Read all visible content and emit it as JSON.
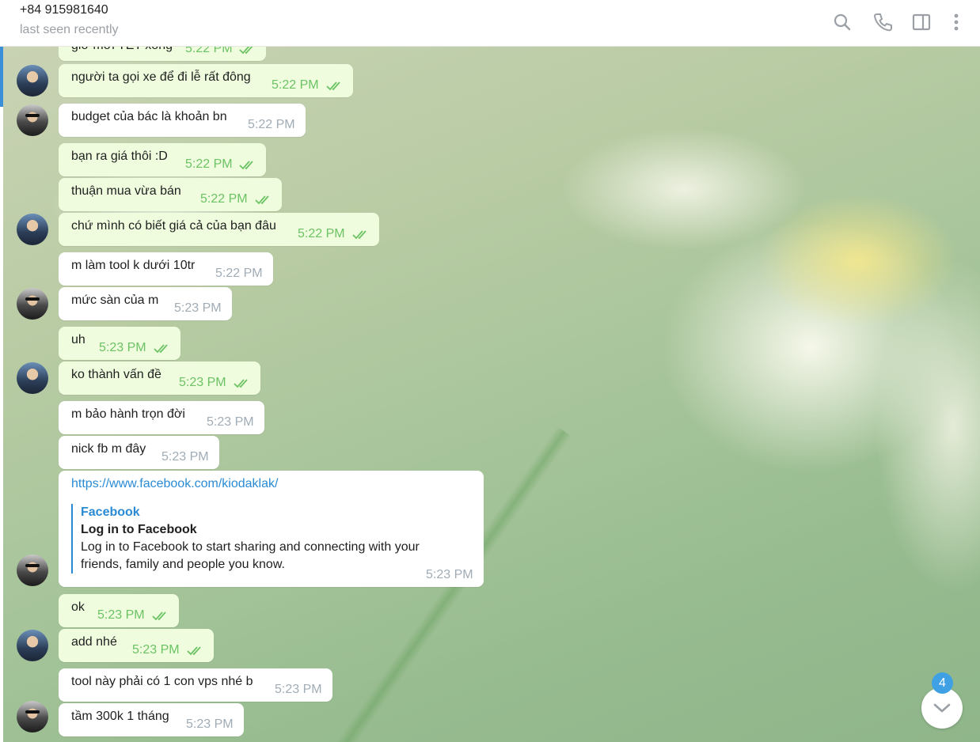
{
  "header": {
    "contact_name": "+84 915981640",
    "status": "last seen recently",
    "icons": [
      "search-icon",
      "phone-icon",
      "side-panel-icon",
      "more-vertical-icon"
    ]
  },
  "messages": [
    {
      "direction": "out",
      "text": "giờ mới TET xong",
      "time": "5:22 PM",
      "status": "read"
    },
    {
      "direction": "out",
      "text": "người ta gọi xe để đi lễ rất đông",
      "time": "5:22 PM",
      "status": "read"
    },
    {
      "direction": "in",
      "text": "budget của bác là khoản bn",
      "time": "5:22 PM"
    },
    {
      "direction": "out",
      "text": "bạn ra giá thôi :D",
      "time": "5:22 PM",
      "status": "read"
    },
    {
      "direction": "out",
      "text": "thuận mua vừa bán",
      "time": "5:22 PM",
      "status": "read"
    },
    {
      "direction": "out",
      "text": "chứ mình có biết giá cả của bạn đâu",
      "time": "5:22 PM",
      "status": "read"
    },
    {
      "direction": "in",
      "text": "m làm tool k dưới 10tr",
      "time": "5:22 PM"
    },
    {
      "direction": "in",
      "text": "mức sàn của m",
      "time": "5:23 PM"
    },
    {
      "direction": "out",
      "text": "uh",
      "time": "5:23 PM",
      "status": "read"
    },
    {
      "direction": "out",
      "text": "ko thành vấn đề",
      "time": "5:23 PM",
      "status": "read"
    },
    {
      "direction": "in",
      "text": "m bảo hành trọn đời",
      "time": "5:23 PM"
    },
    {
      "direction": "in",
      "text": "nick fb m đây",
      "time": "5:23 PM"
    },
    {
      "direction": "in",
      "link": "https://www.facebook.com/kiodaklak/",
      "preview_site": "Facebook",
      "preview_title": "Log in to Facebook",
      "preview_desc": "Log in to Facebook to start sharing and connecting with your friends, family and people you know.",
      "time": "5:23 PM"
    },
    {
      "direction": "out",
      "text": "ok",
      "time": "5:23 PM",
      "status": "read"
    },
    {
      "direction": "out",
      "text": "add nhé",
      "time": "5:23 PM",
      "status": "read"
    },
    {
      "direction": "in",
      "text": "tool này phải có 1 con vps nhé b",
      "time": "5:23 PM"
    },
    {
      "direction": "in",
      "text": "tầm 300k 1 tháng",
      "time": "5:23 PM"
    }
  ],
  "scroll_button": {
    "unread_count": "4",
    "icon": "chevron-down-icon"
  },
  "colors": {
    "outgoing_bubble": "#effdde",
    "incoming_bubble": "#ffffff",
    "read_check": "#6cc264",
    "link": "#2a8bd4",
    "badge": "#3fa1e3"
  }
}
